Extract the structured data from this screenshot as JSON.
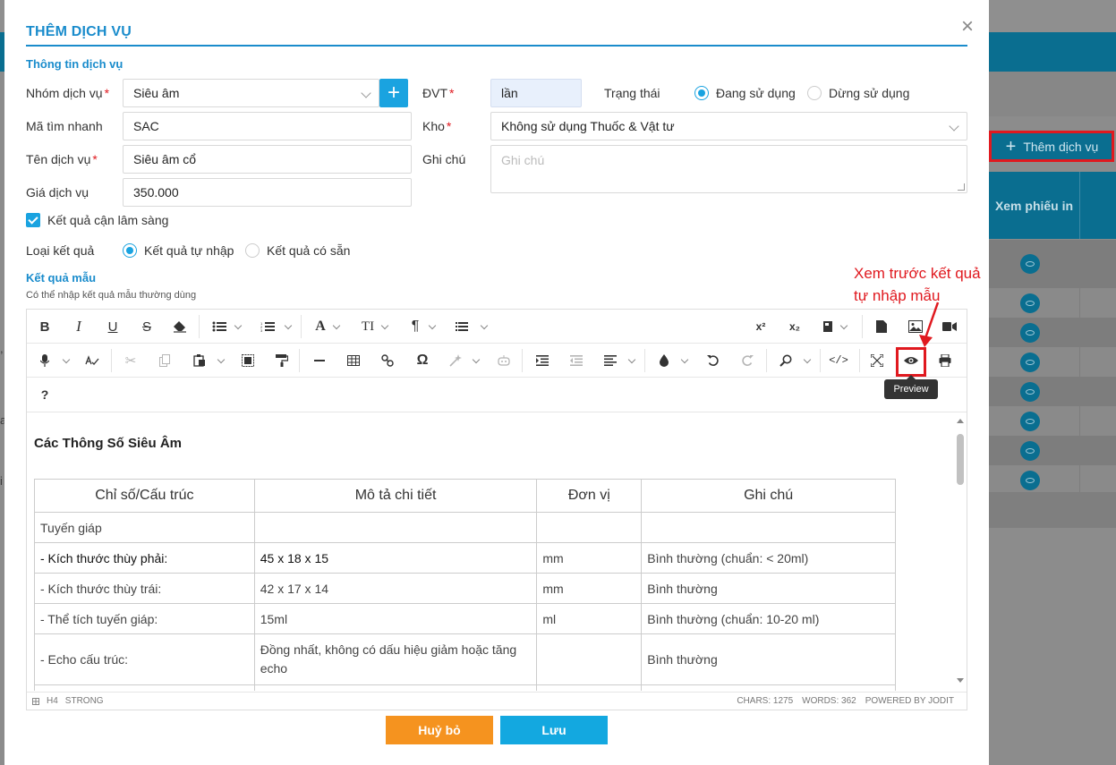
{
  "background": {
    "add_service_button": "Thêm dịch vụ",
    "column_header": "Xem phiếu in",
    "row_count": 8
  },
  "modal": {
    "title": "THÊM DỊCH VỤ",
    "section_info": "Thông tin dịch vụ",
    "fields": {
      "service_group": {
        "label": "Nhóm dịch vụ",
        "value": "Siêu âm"
      },
      "quick_code": {
        "label": "Mã tìm nhanh",
        "value": "SAC"
      },
      "service_name": {
        "label": "Tên dịch vụ",
        "value": "Siêu âm cổ"
      },
      "price": {
        "label": "Giá dịch vụ",
        "value": "350.000"
      },
      "unit": {
        "label": "ĐVT",
        "value": "lần"
      },
      "warehouse": {
        "label": "Kho",
        "value": "Không sử dụng Thuốc & Vật tư"
      },
      "note": {
        "label": "Ghi chú",
        "placeholder": "Ghi chú"
      },
      "status": {
        "label": "Trạng thái",
        "options": [
          "Đang sử dụng",
          "Dừng sử dụng"
        ],
        "selected": 0
      }
    },
    "paraclinical_checkbox": "Kết quả cận lâm sàng",
    "result_type": {
      "label": "Loại kết quả",
      "options": [
        "Kết quả tự nhập",
        "Kết quả có sẵn"
      ],
      "selected": 0
    },
    "section_template": "Kết quả mẫu",
    "template_hint": "Có thể nhập kết quả mẫu thường dùng",
    "editor": {
      "heading": "Các Thông Số Siêu Âm",
      "table_headers": [
        "Chỉ số/Cấu trúc",
        "Mô tả chi tiết",
        "Đơn vị",
        "Ghi chú"
      ],
      "rows": [
        [
          "Tuyến giáp",
          "",
          "",
          ""
        ],
        [
          "- Kích thước thùy phải:",
          "45 x 18 x 15",
          "mm",
          "Bình thường (chuẩn: < 20ml)"
        ],
        [
          "- Kích thước thùy trái:",
          "42 x 17 x 14",
          "mm",
          "Bình thường"
        ],
        [
          "- Thể tích tuyến giáp:",
          "15ml",
          "ml",
          "Bình thường (chuẩn: 10-20 ml)"
        ],
        [
          "- Echo cấu trúc:",
          "Đồng nhất, không có dấu hiệu giảm hoặc tăng echo",
          "",
          "Bình thường"
        ]
      ],
      "help_label": "?",
      "tooltip": "Preview",
      "status_left": [
        "H4",
        "STRONG"
      ],
      "status_chars": "CHARS: 1275",
      "status_words": "WORDS: 362",
      "status_powered": "POWERED BY JODIT"
    },
    "buttons": {
      "cancel": "Huỷ bỏ",
      "save": "Lưu"
    }
  },
  "annotation": {
    "line1": "Xem trước kết quả",
    "line2": "tự nhập mẫu",
    "color": "#e0191f"
  },
  "colors": {
    "accent": "#1a8ccc",
    "primary": "#13a8e0",
    "cancel": "#f5931f",
    "header_bg": "#0a6e90"
  }
}
